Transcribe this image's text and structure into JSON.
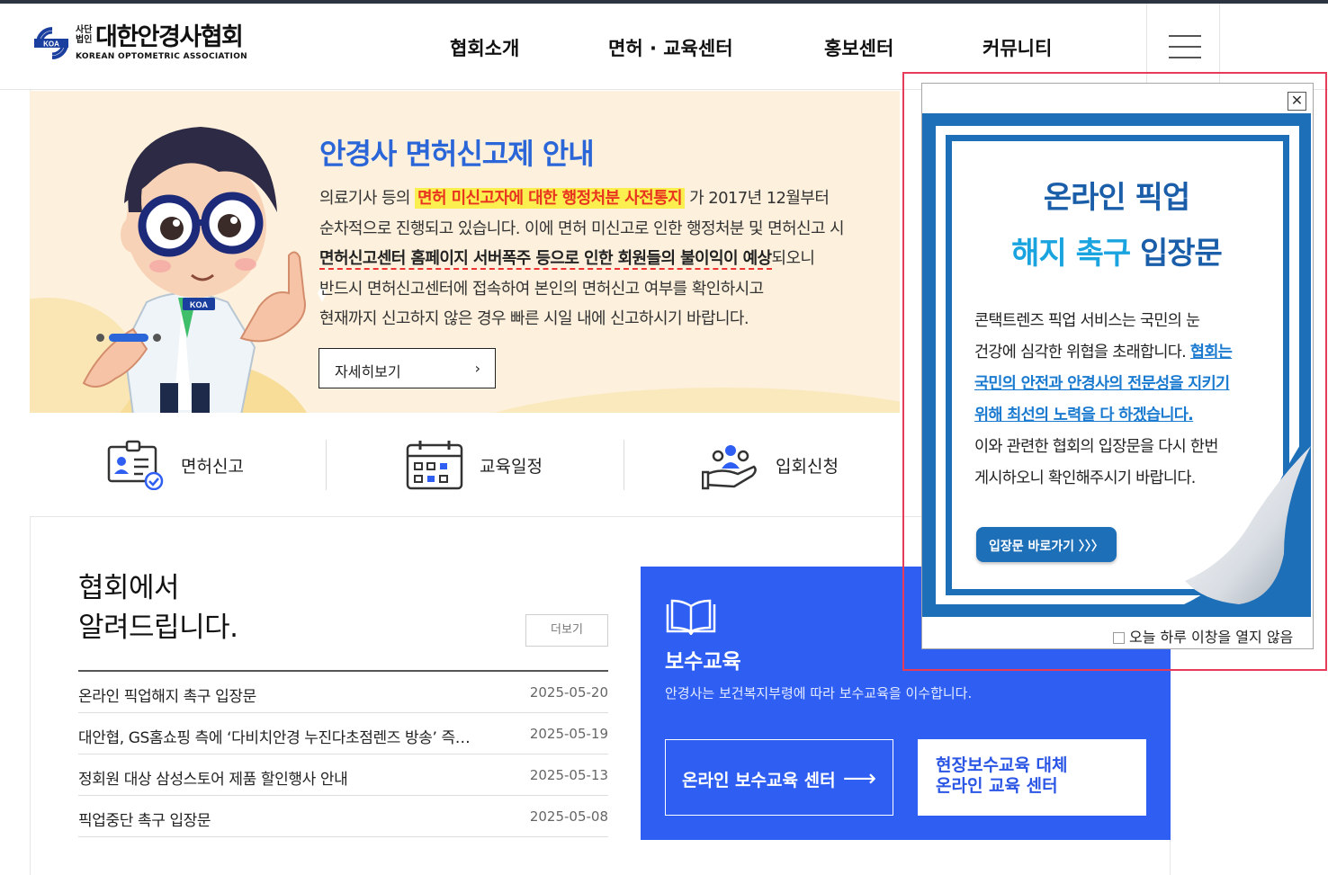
{
  "header": {
    "logo_small": "사단 법인",
    "logo_main": "대한안경사협회",
    "logo_en": "KOREAN OPTOMETRIC ASSOCIATION",
    "logo_emblem_text": "KOA",
    "nav": [
      "협회소개",
      "면허 · 교육센터",
      "홍보센터",
      "커뮤니티"
    ]
  },
  "hero": {
    "title": "안경사 면허신고제 안내",
    "line1_pre": "의료기사 등의 ",
    "line1_highlight": "면허 미신고자에 대한 행정처분 사전통지",
    "line1_post": " 가 2017년 12월부터",
    "line2": "순차적으로 진행되고 있습니다. 이에 면허 미신고로 인한 행정처분 및 면허신고 시",
    "line3_underline": "면허신고센터 홈페이지 서버폭주 등으로 인한 회원들의 불이익이 예상",
    "line3_post": "되오니",
    "line4": "반드시 면허신고센터에 접속하여 본인의 면허신고 여부를 확인하시고",
    "line5": "현재까지 신고하지 않은 경우 빠른 시일 내에 신고하시기 바랍니다.",
    "button": "자세히보기",
    "badge_text": "KOA"
  },
  "quick_links": [
    {
      "label": "면허신고",
      "icon": "license-report-icon"
    },
    {
      "label": "교육일정",
      "icon": "calendar-icon"
    },
    {
      "label": "입회신청",
      "icon": "membership-icon"
    }
  ],
  "notice": {
    "title_line1": "협회에서",
    "title_line2": "알려드립니다.",
    "more": "더보기",
    "items": [
      {
        "title": "온라인 픽업해지 촉구 입장문",
        "date": "2025-05-20"
      },
      {
        "title": "대안협, GS홈쇼핑 측에 ‘다비치안경 누진다초점렌즈 방송’ 즉…",
        "date": "2025-05-19"
      },
      {
        "title": "정회원 대상 삼성스토어 제품 할인행사 안내",
        "date": "2025-05-13"
      },
      {
        "title": "픽업중단 촉구 입장문",
        "date": "2025-05-08"
      }
    ]
  },
  "education": {
    "title": "보수교육",
    "desc": "안경사는 보건복지부령에 따라 보수교육을 이수합니다.",
    "btn1": "온라인 보수교육 센터",
    "btn2_line1": "현장보수교육 대체",
    "btn2_line2": "온라인 교육 센터"
  },
  "popup": {
    "title1": "온라인 픽업",
    "title2_accent": "해지 촉구",
    "title2_rest": " 입장문",
    "body1": "콘택트렌즈 픽업 서비스는 국민의 눈",
    "body2_pre": "건강에 심각한 위협을 초래합니다. ",
    "body2_link": "협회는",
    "body3_link": "국민의 안전과 안경사의 전문성을 지키기",
    "body4_link": "위해 최선의 노력을 다 하겠습니다.",
    "body5": "이와 관련한 협회의 입장문을 다시 한번",
    "body6": "게시하오니 확인해주시기 바랍니다.",
    "button": "입장문 바로가기 〉〉〉",
    "close": "✕",
    "dont_show": "오늘 하루 이창을 열지 않음"
  },
  "colors": {
    "hero_title": "#2a66d8",
    "edu_bg": "#2f5ff2",
    "popup_blue": "#1d6fb8",
    "highlight_bg": "#fbef4f",
    "highlight_text": "#e8341f"
  }
}
